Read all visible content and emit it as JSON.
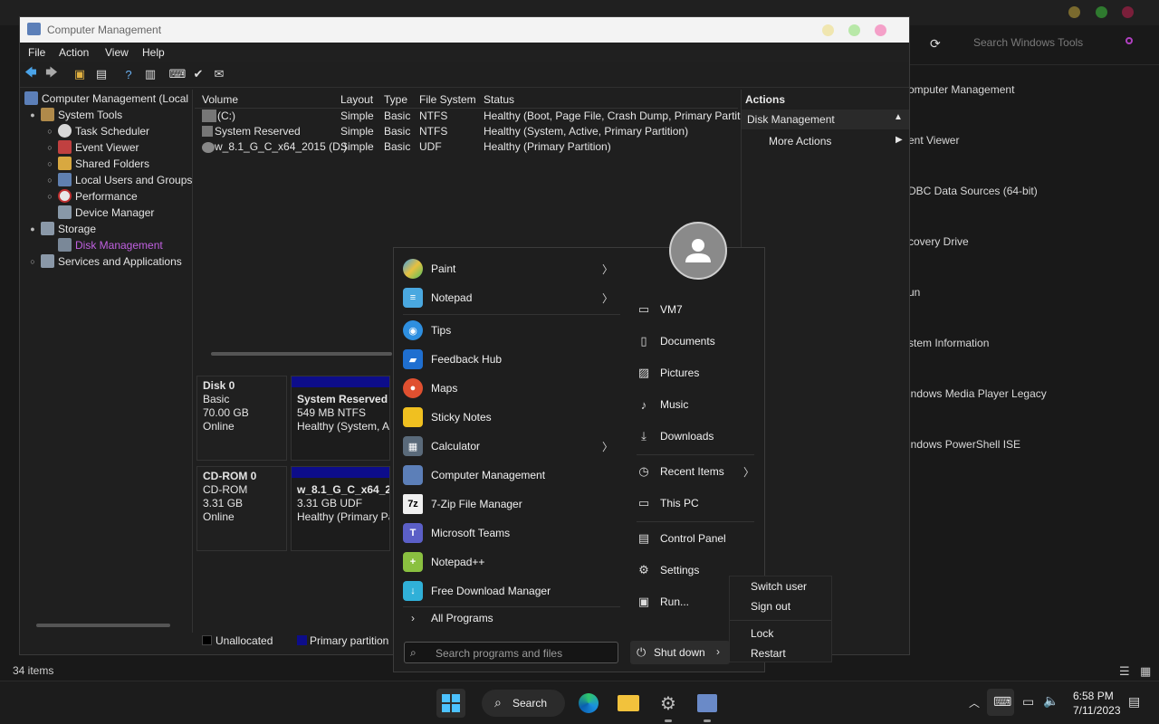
{
  "background_window": {
    "search_placeholder": "Search Windows Tools",
    "items": [
      "omputer Management",
      "ent Viewer",
      "DBC Data Sources (64-bit)",
      "covery Drive",
      "un",
      "stem Information",
      "indows Media Player Legacy",
      "indows PowerShell ISE"
    ],
    "status": "34 items"
  },
  "cm": {
    "title": "Computer Management",
    "menu": [
      "File",
      "Action",
      "View",
      "Help"
    ],
    "tree": [
      {
        "label": "Computer Management (Local",
        "level": 0
      },
      {
        "label": "System Tools",
        "level": 1
      },
      {
        "label": "Task Scheduler",
        "level": 2
      },
      {
        "label": "Event Viewer",
        "level": 2
      },
      {
        "label": "Shared Folders",
        "level": 2
      },
      {
        "label": "Local Users and Groups",
        "level": 2
      },
      {
        "label": "Performance",
        "level": 2
      },
      {
        "label": "Device Manager",
        "level": 2
      },
      {
        "label": "Storage",
        "level": 1
      },
      {
        "label": "Disk Management",
        "level": 2
      },
      {
        "label": "Services and Applications",
        "level": 1
      }
    ],
    "volume_headers": [
      "Volume",
      "Layout",
      "Type",
      "File System",
      "Status"
    ],
    "volumes": [
      [
        "(C:)",
        "Simple",
        "Basic",
        "NTFS",
        "Healthy (Boot, Page File, Crash Dump, Primary Partit"
      ],
      [
        "System Reserved",
        "Simple",
        "Basic",
        "NTFS",
        "Healthy (System, Active, Primary Partition)"
      ],
      [
        "w_8.1_G_C_x64_2015 (D:)",
        "Simple",
        "Basic",
        "UDF",
        "Healthy (Primary Partition)"
      ]
    ],
    "disks": [
      {
        "name": "Disk 0",
        "type": "Basic",
        "size": "70.00 GB",
        "state": "Online",
        "part_name": "System Reserved",
        "part_size": "549 MB NTFS",
        "part_status": "Healthy (System, A"
      },
      {
        "name": "CD-ROM 0",
        "type": "CD-ROM",
        "size": "3.31 GB",
        "state": "Online",
        "part_name": "w_8.1_G_C_x64_201",
        "part_size": "3.31 GB UDF",
        "part_status": "Healthy (Primary Pa"
      }
    ],
    "legend": {
      "unallocated": "Unallocated",
      "primary": "Primary partition"
    },
    "actions": {
      "title": "Actions",
      "section": "Disk Management",
      "more": "More Actions"
    }
  },
  "start": {
    "apps": [
      "Paint",
      "Notepad",
      "Tips",
      "Feedback Hub",
      "Maps",
      "Sticky Notes",
      "Calculator",
      "Computer Management",
      "7-Zip File Manager",
      "Microsoft Teams",
      "Notepad++",
      "Free Download Manager"
    ],
    "all_programs": "All Programs",
    "places": [
      "VM7",
      "Documents",
      "Pictures",
      "Music",
      "Downloads",
      "Recent Items",
      "This PC",
      "Control Panel",
      "Settings",
      "Run..."
    ],
    "search_placeholder": "Search programs and files",
    "shutdown": "Shut down",
    "power_menu": [
      "Switch user",
      "Sign out",
      "Lock",
      "Restart"
    ]
  },
  "taskbar": {
    "search": "Search",
    "time": "6:58 PM",
    "date": "7/11/2023"
  }
}
